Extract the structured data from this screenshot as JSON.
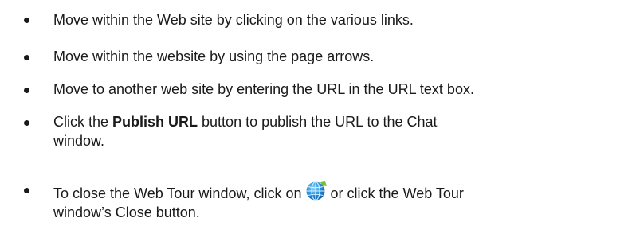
{
  "items": [
    {
      "text": "Move within the Web site by clicking on the various links."
    },
    {
      "text": "Move within the website by using the page arrows."
    },
    {
      "text": "Move to another web site by entering the URL in the URL text box."
    },
    {
      "prefix": "Click the ",
      "bold": "Publish URL",
      "suffix_line1": " button to publish the URL to the Chat",
      "line2": "window."
    },
    {
      "prefix": "To close the Web Tour window, click on",
      "icon": "web-tour-globe-icon",
      "suffix_line1": "or click the Web Tour",
      "line2": "window’s Close button."
    }
  ]
}
